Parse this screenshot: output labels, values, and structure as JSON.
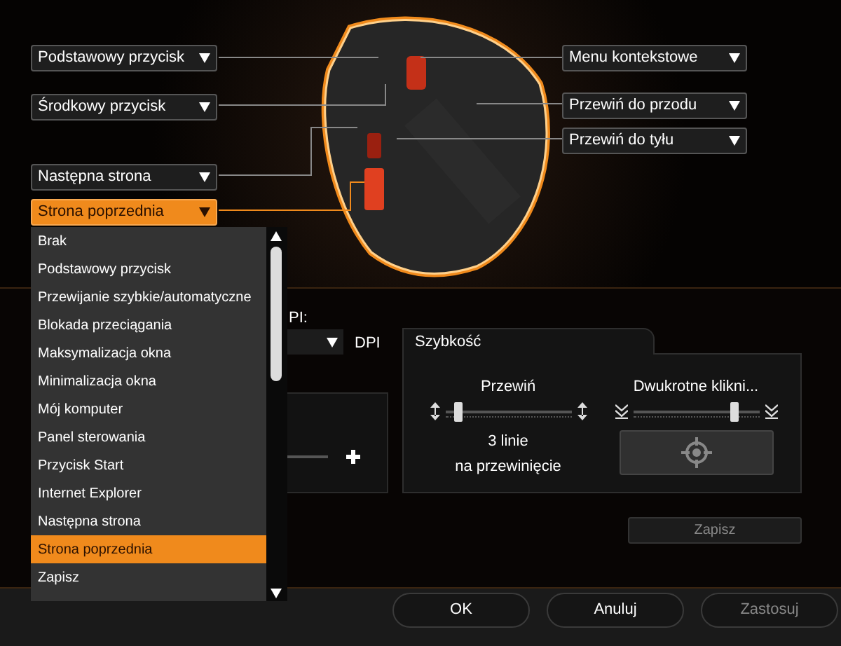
{
  "left_buttons": [
    {
      "label": "Podstawowy przycisk",
      "selected": false
    },
    {
      "label": "Środkowy przycisk",
      "selected": false
    },
    {
      "label": "Następna strona",
      "selected": false
    },
    {
      "label": "Strona poprzednia",
      "selected": true
    }
  ],
  "right_buttons": [
    {
      "label": "Menu kontekstowe",
      "selected": false
    },
    {
      "label": "Przewiń do przodu",
      "selected": false
    },
    {
      "label": "Przewiń do tyłu",
      "selected": false
    }
  ],
  "dropdown_list": [
    {
      "label": "Brak",
      "selected": false
    },
    {
      "label": "Podstawowy przycisk",
      "selected": false
    },
    {
      "label": "Przewijanie szybkie/automatyczne",
      "selected": false
    },
    {
      "label": "Blokada przeciągania",
      "selected": false
    },
    {
      "label": "Maksymalizacja okna",
      "selected": false
    },
    {
      "label": "Minimalizacja okna",
      "selected": false
    },
    {
      "label": "Mój komputer",
      "selected": false
    },
    {
      "label": "Panel sterowania",
      "selected": false
    },
    {
      "label": "Przycisk Start",
      "selected": false
    },
    {
      "label": "Internet Explorer",
      "selected": false
    },
    {
      "label": "Następna strona",
      "selected": false
    },
    {
      "label": "Strona poprzednia",
      "selected": true
    },
    {
      "label": "Zapisz",
      "selected": false
    }
  ],
  "dpi": {
    "label": "PI:",
    "unit": "DPI"
  },
  "speed": {
    "title": "Szybkość",
    "scroll": {
      "label": "Przewiń",
      "level": 0.1,
      "reading": "3 linie",
      "reading_2": "na przewinięcie"
    },
    "double_click": {
      "label": "Dwukrotne klikni...",
      "level": 0.8
    }
  },
  "save_button": {
    "label": "Zapisz",
    "disabled": true
  },
  "footer_buttons": [
    {
      "label": "OK",
      "disabled": false
    },
    {
      "label": "Anuluj",
      "disabled": false
    },
    {
      "label": "Zastosuj",
      "disabled": true
    }
  ]
}
